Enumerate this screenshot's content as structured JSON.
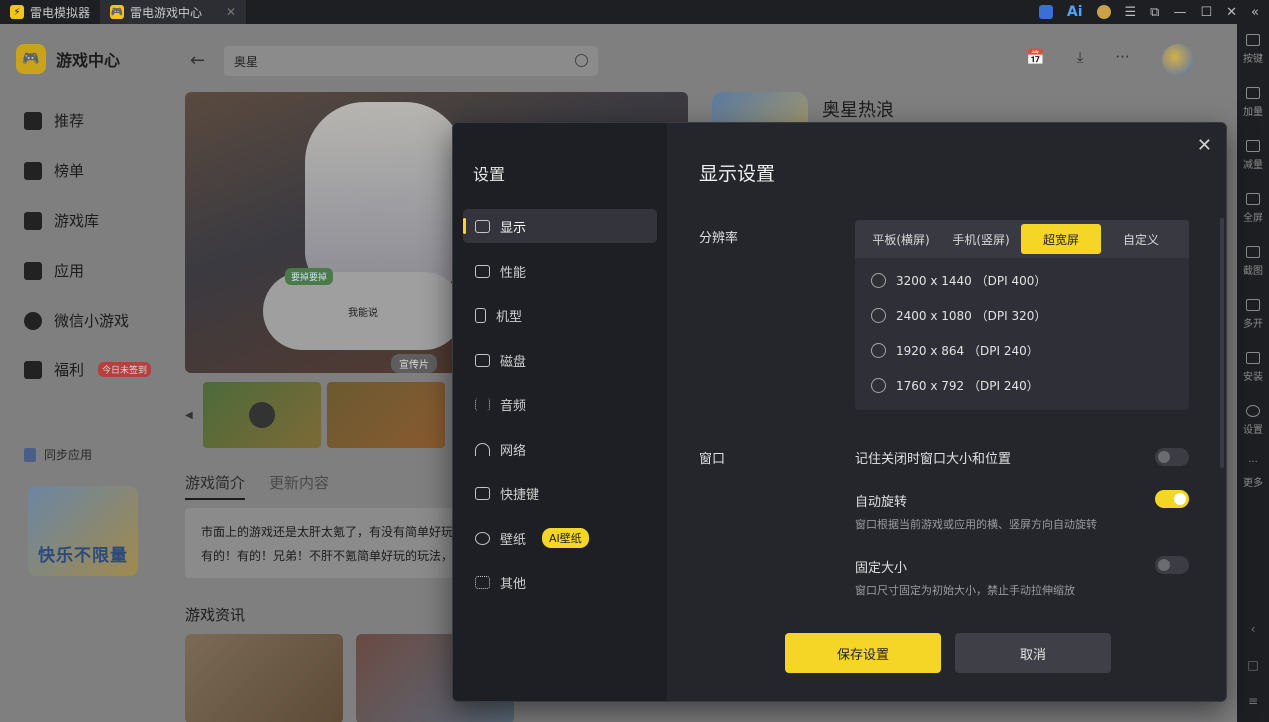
{
  "titlebar": {
    "tabs": [
      {
        "label": "雷电模拟器",
        "icon": "ld-logo-icon"
      },
      {
        "label": "雷电游戏中心",
        "icon": "game-center-icon"
      }
    ],
    "right_icons": [
      "lightning-icon",
      "ai-icon",
      "coin-icon",
      "menu-icon",
      "popout-icon",
      "minimize-icon",
      "maximize-icon",
      "close-icon",
      "collapse-icon"
    ],
    "ai_text": "Ai"
  },
  "rightbar": {
    "items": [
      {
        "label": "按键",
        "icon": "keyboard-icon"
      },
      {
        "label": "加量",
        "icon": "volume-up-icon"
      },
      {
        "label": "减量",
        "icon": "volume-down-icon"
      },
      {
        "label": "全屏",
        "icon": "fullscreen-icon"
      },
      {
        "label": "截图",
        "icon": "scissors-icon"
      },
      {
        "label": "多开",
        "icon": "multi-instance-icon"
      },
      {
        "label": "安装",
        "icon": "install-icon"
      },
      {
        "label": "设置",
        "icon": "gear-icon"
      },
      {
        "label": "更多",
        "icon": "more-icon"
      }
    ]
  },
  "gamecenter": {
    "brand": "游戏中心",
    "nav": [
      {
        "label": "推荐",
        "icon": "rocket-icon"
      },
      {
        "label": "榜单",
        "icon": "chart-icon"
      },
      {
        "label": "游戏库",
        "icon": "gamepad-icon"
      },
      {
        "label": "应用",
        "icon": "grid-icon"
      },
      {
        "label": "微信小游戏",
        "icon": "sparkle-icon"
      },
      {
        "label": "福利",
        "icon": "gift-icon",
        "badge": "今日未签到"
      }
    ],
    "sync_label": "同步应用",
    "promo_text": "快乐不限量",
    "search_value": "奥星",
    "hero_bubble_text": "我能说",
    "hero_bubble_tag": "要掉要掉",
    "hero_tag": "宣传片",
    "tabs": [
      {
        "label": "游戏简介",
        "active": true
      },
      {
        "label": "更新内容",
        "active": false
      }
    ],
    "description_lines": [
      "市面上的游戏还是太肝太氪了，有没有简单好玩",
      "有的！有的！兄弟！不肝不氪简单好玩的玩法，"
    ],
    "news_title": "游戏资讯",
    "game_title": "奥星热浪"
  },
  "settings": {
    "title": "设置",
    "menu": [
      {
        "label": "显示",
        "icon": "monitor-icon",
        "active": true
      },
      {
        "label": "性能",
        "icon": "performance-icon"
      },
      {
        "label": "机型",
        "icon": "phone-icon"
      },
      {
        "label": "磁盘",
        "icon": "disk-icon"
      },
      {
        "label": "音频",
        "icon": "audio-icon"
      },
      {
        "label": "网络",
        "icon": "wifi-icon"
      },
      {
        "label": "快捷键",
        "icon": "keyboard-icon"
      },
      {
        "label": "壁纸",
        "icon": "palette-icon",
        "badge": "AI壁纸"
      },
      {
        "label": "其他",
        "icon": "grid-icon"
      }
    ],
    "display": {
      "title": "显示设置",
      "resolution_label": "分辨率",
      "resolution_tabs": [
        {
          "label": "平板(横屏)",
          "active": false
        },
        {
          "label": "手机(竖屏)",
          "active": false
        },
        {
          "label": "超宽屏",
          "active": true
        },
        {
          "label": "自定义",
          "active": false
        }
      ],
      "resolution_options": [
        "3200 x 1440 （DPI 400）",
        "2400 x 1080 （DPI 320）",
        "1920 x 864 （DPI 240）",
        "1760 x 792 （DPI 240）"
      ],
      "window_label": "窗口",
      "window_options": [
        {
          "label": "记住关闭时窗口大小和位置",
          "desc": "",
          "on": false
        },
        {
          "label": "自动旋转",
          "desc": "窗口根据当前游戏或应用的横、竖屏方向自动旋转",
          "on": true
        },
        {
          "label": "固定大小",
          "desc": "窗口尺寸固定为初始大小，禁止手动拉伸缩放",
          "on": false
        }
      ],
      "save_label": "保存设置",
      "cancel_label": "取消"
    }
  },
  "colors": {
    "accent": "#f5d626",
    "modal_bg": "#25262c",
    "sidebar_bg": "#1e1f24"
  }
}
